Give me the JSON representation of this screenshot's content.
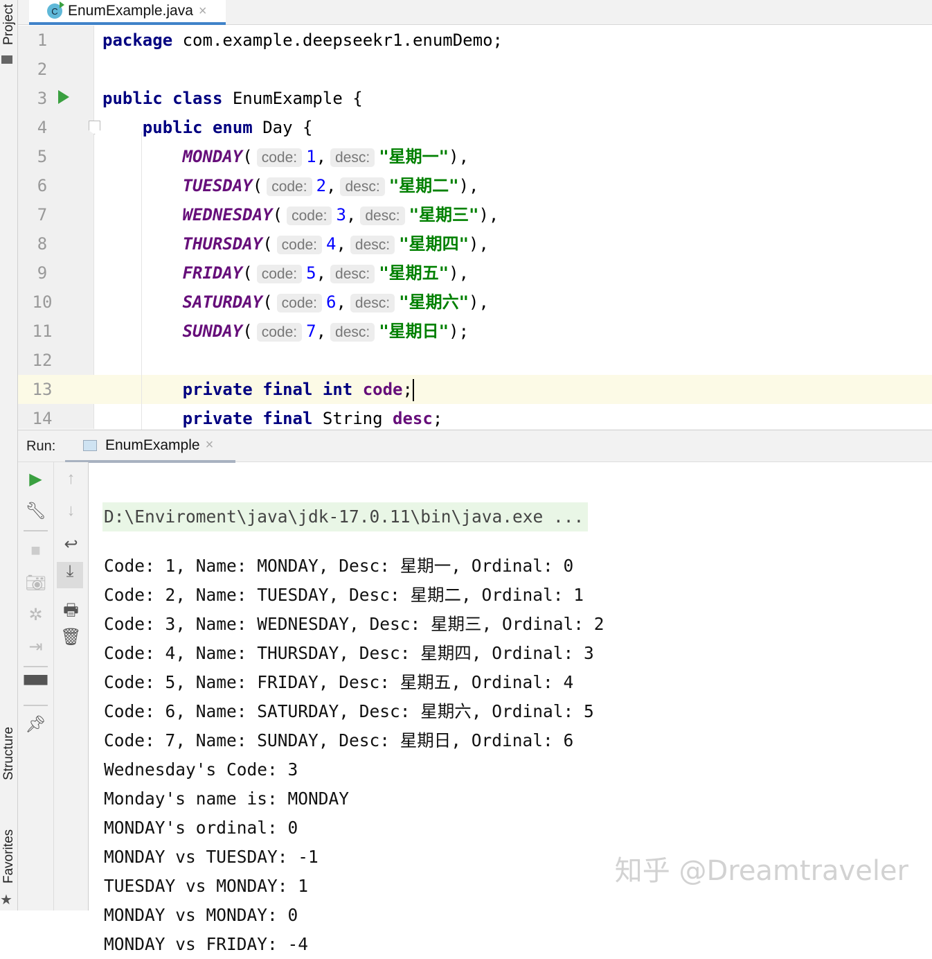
{
  "side_tabs": {
    "project": "Project",
    "structure": "Structure",
    "favorites": "Favorites"
  },
  "file_tab": {
    "icon": "C",
    "label": "EnumExample.java",
    "close": "×"
  },
  "editor": {
    "current_line": 13,
    "lines": [
      [
        {
          "t": "kw",
          "v": "package"
        },
        {
          "v": " com.example.deepseekr1.enumDemo;"
        }
      ],
      [],
      [
        {
          "t": "kw",
          "v": "public class"
        },
        {
          "v": " EnumExample {"
        }
      ],
      [
        {
          "v": "    "
        },
        {
          "t": "kw",
          "v": "public enum"
        },
        {
          "v": " Day {"
        }
      ],
      [
        {
          "v": "        "
        },
        {
          "t": "en",
          "v": "MONDAY"
        },
        {
          "v": "("
        },
        {
          "t": "hint",
          "v": "code:"
        },
        {
          "t": "num",
          "v": "1"
        },
        {
          "v": ","
        },
        {
          "t": "hint",
          "v": "desc:"
        },
        {
          "t": "str",
          "v": "\"星期一\""
        },
        {
          "v": "),"
        }
      ],
      [
        {
          "v": "        "
        },
        {
          "t": "en",
          "v": "TUESDAY"
        },
        {
          "v": "("
        },
        {
          "t": "hint",
          "v": "code:"
        },
        {
          "t": "num",
          "v": "2"
        },
        {
          "v": ","
        },
        {
          "t": "hint",
          "v": "desc:"
        },
        {
          "t": "str",
          "v": "\"星期二\""
        },
        {
          "v": "),"
        }
      ],
      [
        {
          "v": "        "
        },
        {
          "t": "en",
          "v": "WEDNESDAY"
        },
        {
          "v": "("
        },
        {
          "t": "hint",
          "v": "code:"
        },
        {
          "t": "num",
          "v": "3"
        },
        {
          "v": ","
        },
        {
          "t": "hint",
          "v": "desc:"
        },
        {
          "t": "str",
          "v": "\"星期三\""
        },
        {
          "v": "),"
        }
      ],
      [
        {
          "v": "        "
        },
        {
          "t": "en",
          "v": "THURSDAY"
        },
        {
          "v": "("
        },
        {
          "t": "hint",
          "v": "code:"
        },
        {
          "t": "num",
          "v": "4"
        },
        {
          "v": ","
        },
        {
          "t": "hint",
          "v": "desc:"
        },
        {
          "t": "str",
          "v": "\"星期四\""
        },
        {
          "v": "),"
        }
      ],
      [
        {
          "v": "        "
        },
        {
          "t": "en",
          "v": "FRIDAY"
        },
        {
          "v": "("
        },
        {
          "t": "hint",
          "v": "code:"
        },
        {
          "t": "num",
          "v": "5"
        },
        {
          "v": ","
        },
        {
          "t": "hint",
          "v": "desc:"
        },
        {
          "t": "str",
          "v": "\"星期五\""
        },
        {
          "v": "),"
        }
      ],
      [
        {
          "v": "        "
        },
        {
          "t": "en",
          "v": "SATURDAY"
        },
        {
          "v": "("
        },
        {
          "t": "hint",
          "v": "code:"
        },
        {
          "t": "num",
          "v": "6"
        },
        {
          "v": ","
        },
        {
          "t": "hint",
          "v": "desc:"
        },
        {
          "t": "str",
          "v": "\"星期六\""
        },
        {
          "v": "),"
        }
      ],
      [
        {
          "v": "        "
        },
        {
          "t": "en",
          "v": "SUNDAY"
        },
        {
          "v": "("
        },
        {
          "t": "hint",
          "v": "code:"
        },
        {
          "t": "num",
          "v": "7"
        },
        {
          "v": ","
        },
        {
          "t": "hint",
          "v": "desc:"
        },
        {
          "t": "str",
          "v": "\"星期日\""
        },
        {
          "v": ");"
        }
      ],
      [],
      [
        {
          "v": "        "
        },
        {
          "t": "kw",
          "v": "private final int"
        },
        {
          "v": " "
        },
        {
          "t": "fld",
          "v": "code"
        },
        {
          "v": ";"
        },
        {
          "t": "caret",
          "v": ""
        }
      ],
      [
        {
          "v": "        "
        },
        {
          "t": "kw",
          "v": "private final"
        },
        {
          "v": " String "
        },
        {
          "t": "fld",
          "v": "desc"
        },
        {
          "v": ";"
        }
      ]
    ]
  },
  "run": {
    "label": "Run:",
    "tab": "EnumExample",
    "close": "×"
  },
  "console": {
    "command": "D:\\Enviroment\\java\\jdk-17.0.11\\bin\\java.exe ...",
    "lines": [
      "Code: 1, Name: MONDAY, Desc: 星期一, Ordinal: 0",
      "Code: 2, Name: TUESDAY, Desc: 星期二, Ordinal: 1",
      "Code: 3, Name: WEDNESDAY, Desc: 星期三, Ordinal: 2",
      "Code: 4, Name: THURSDAY, Desc: 星期四, Ordinal: 3",
      "Code: 5, Name: FRIDAY, Desc: 星期五, Ordinal: 4",
      "Code: 6, Name: SATURDAY, Desc: 星期六, Ordinal: 5",
      "Code: 7, Name: SUNDAY, Desc: 星期日, Ordinal: 6",
      "Wednesday's Code: 3",
      "Monday's name is: MONDAY",
      "MONDAY's ordinal: 0",
      "MONDAY vs TUESDAY: -1",
      "TUESDAY vs MONDAY: 1",
      "MONDAY vs MONDAY: 0",
      "MONDAY vs FRIDAY: -4"
    ]
  },
  "watermark": "知乎 @Dreamtraveler"
}
